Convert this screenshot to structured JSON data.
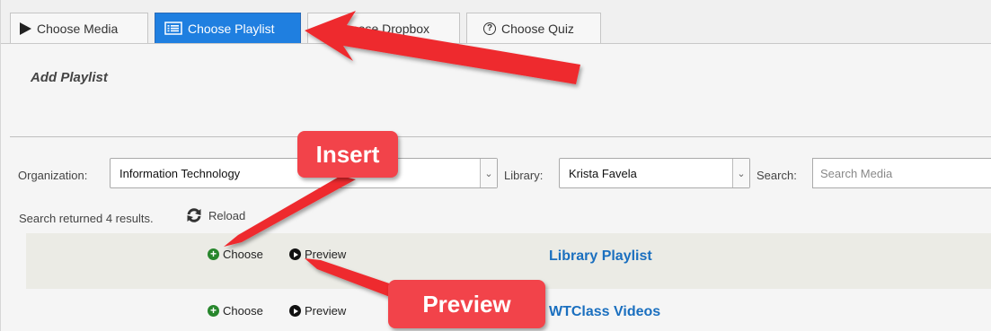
{
  "tabs": [
    {
      "label": "Choose Media",
      "icon": "play-icon"
    },
    {
      "label": "Choose Playlist",
      "icon": "list-icon"
    },
    {
      "label": "Choose Dropbox",
      "icon": "dropbox-icon"
    },
    {
      "label": "Choose Quiz",
      "icon": "question-circle-icon"
    }
  ],
  "panel": {
    "title": "Add Playlist"
  },
  "filters": {
    "organization_label": "Organization:",
    "organization_value": "Information Technology",
    "library_label": "Library:",
    "library_value": "Krista Favela",
    "search_label": "Search:",
    "search_placeholder": "Search Media"
  },
  "results": {
    "summary": "Search returned 4 results.",
    "reload_label": "Reload"
  },
  "rows": [
    {
      "choose_label": "Choose",
      "preview_label": "Preview",
      "title": "Library Playlist"
    },
    {
      "choose_label": "Choose",
      "preview_label": "Preview",
      "title": "WTClass Videos"
    }
  ],
  "annotations": {
    "insert_label": "Insert",
    "preview_label": "Preview"
  },
  "colors": {
    "active_tab": "#1f7fe0",
    "callout": "#f2434a",
    "link": "#1a6fbf",
    "choose_icon": "#27862c"
  }
}
